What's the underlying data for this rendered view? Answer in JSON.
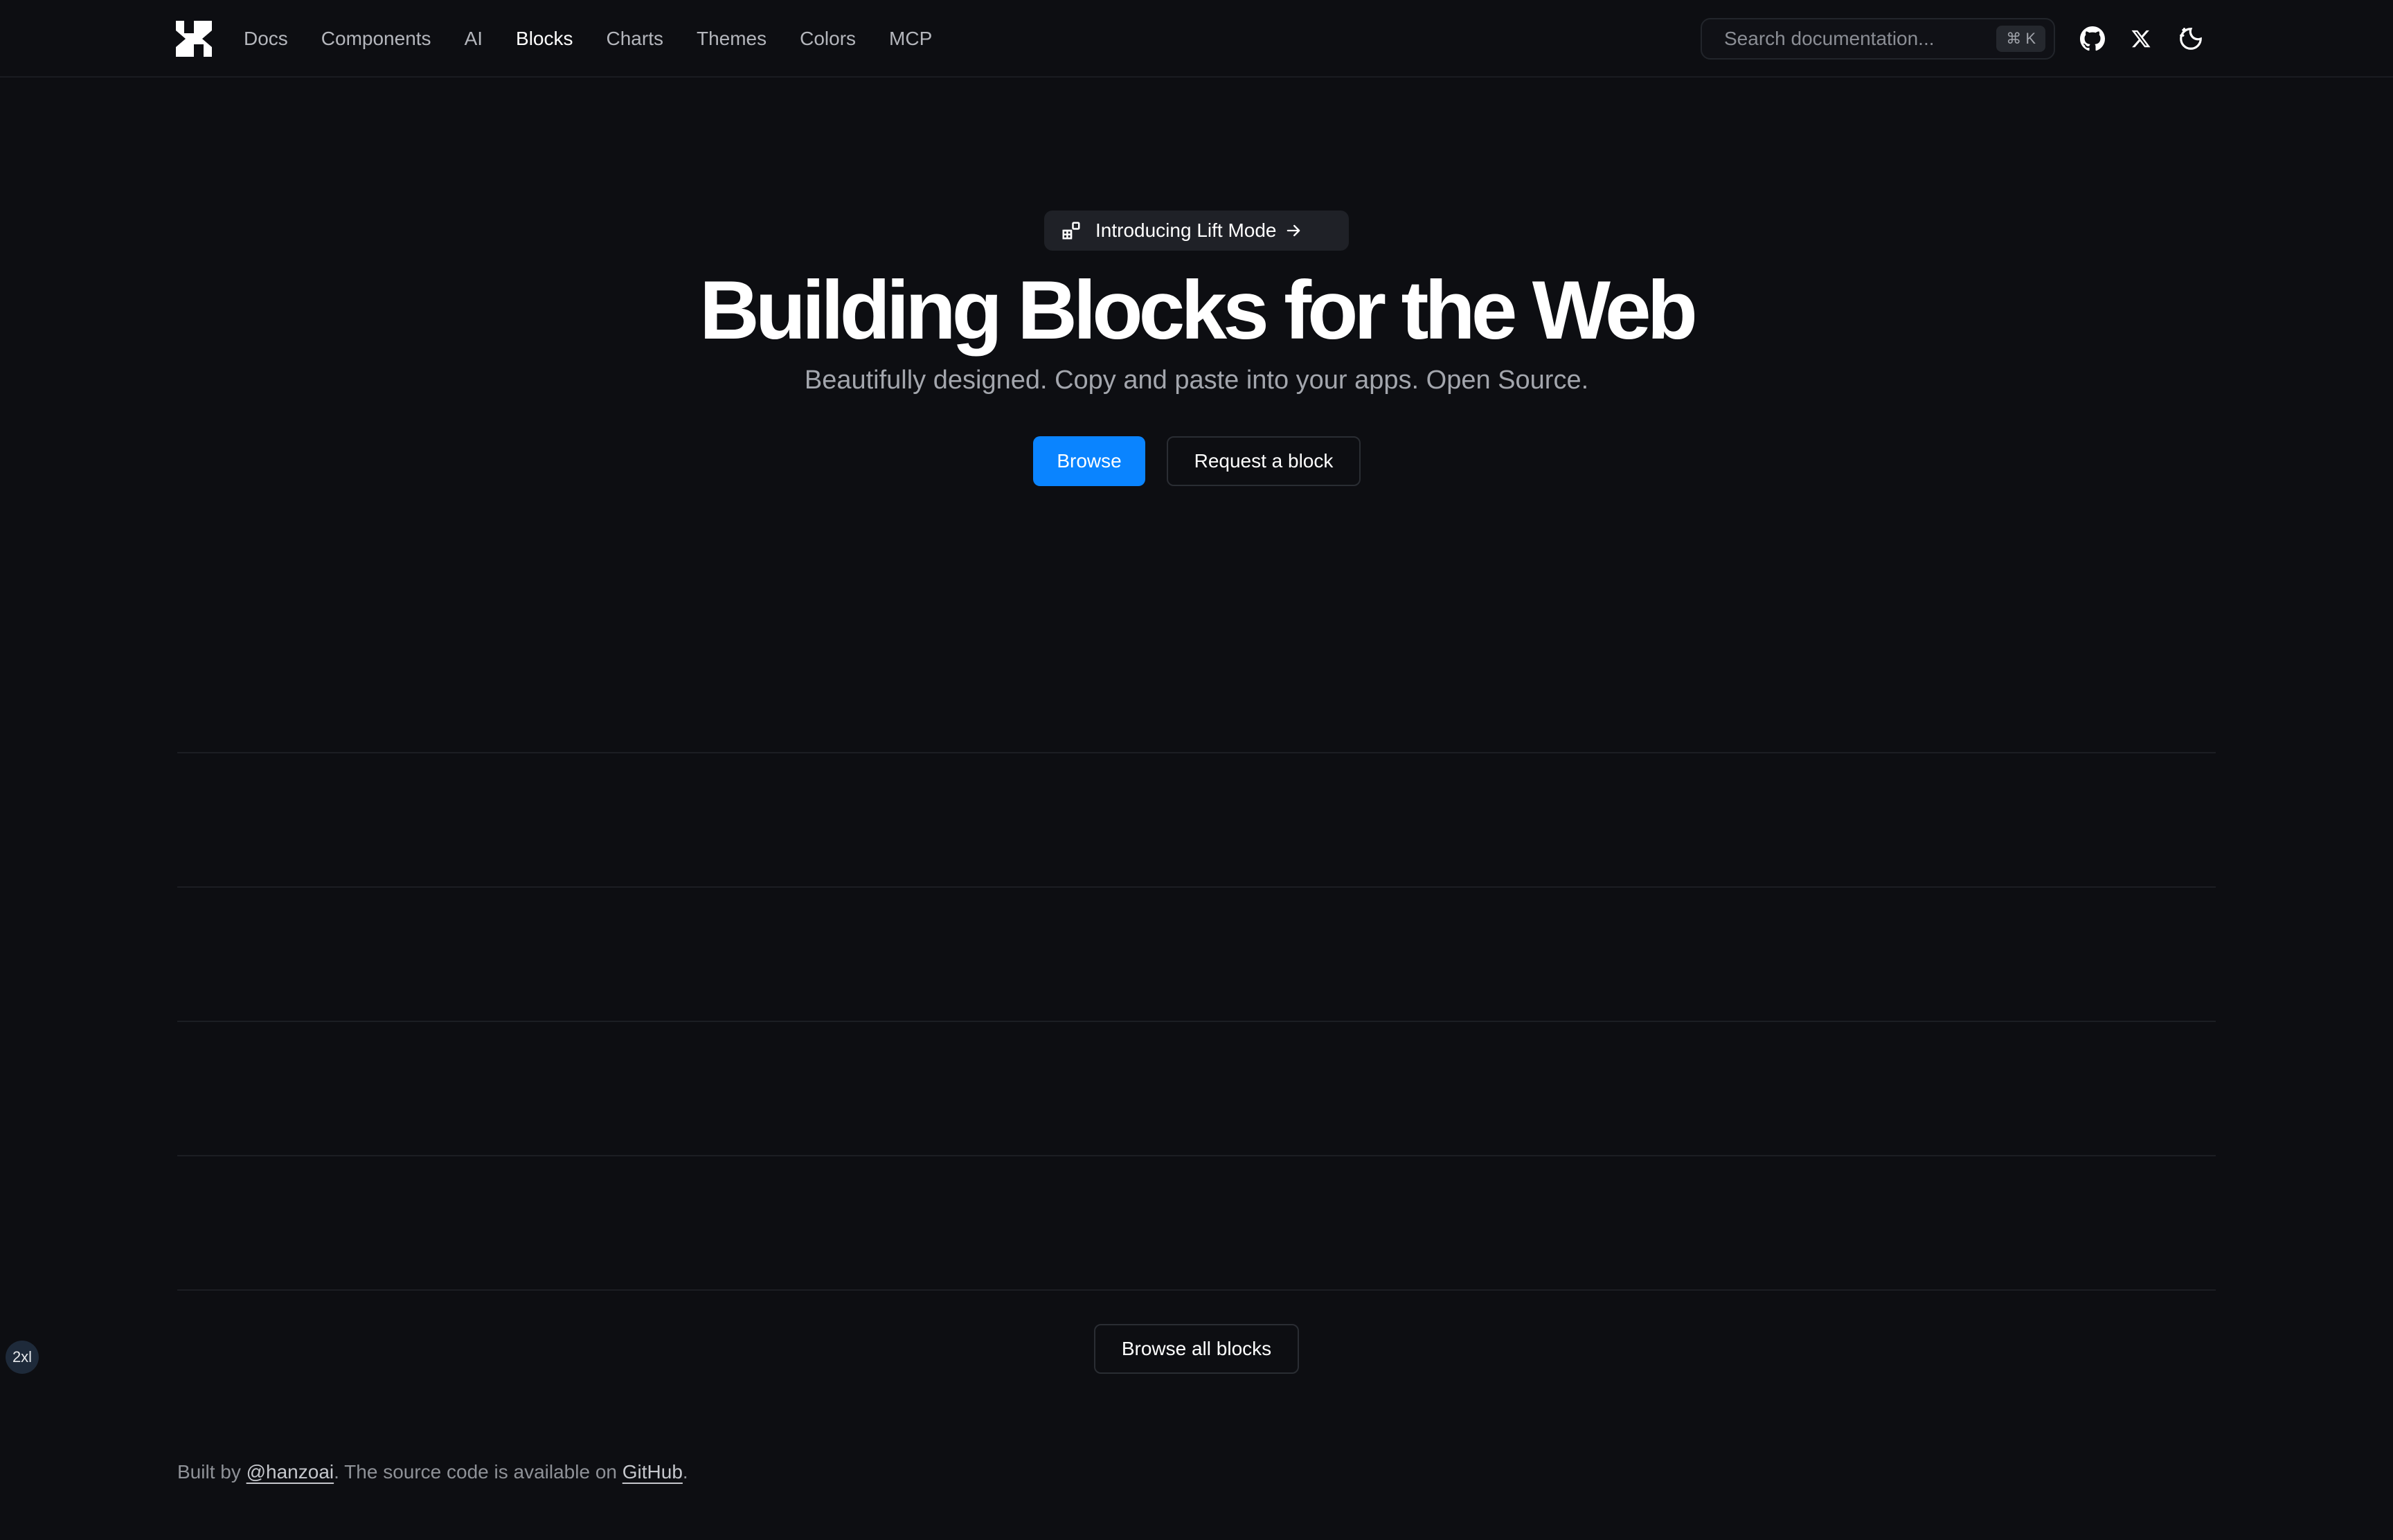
{
  "header": {
    "nav": [
      {
        "label": "Docs",
        "active": false
      },
      {
        "label": "Components",
        "active": false
      },
      {
        "label": "AI",
        "active": false
      },
      {
        "label": "Blocks",
        "active": true
      },
      {
        "label": "Charts",
        "active": false
      },
      {
        "label": "Themes",
        "active": false
      },
      {
        "label": "Colors",
        "active": false
      },
      {
        "label": "MCP",
        "active": false
      }
    ],
    "search": {
      "placeholder": "Search documentation...",
      "shortcut": "⌘ K"
    },
    "icons": [
      "github-icon",
      "x-icon",
      "theme-toggle-icon"
    ]
  },
  "hero": {
    "announcement": "Introducing Lift Mode",
    "title": "Building Blocks for the Web",
    "subtitle": "Beautifully designed. Copy and paste into your apps. Open Source.",
    "primary_button": "Browse",
    "secondary_button": "Request a block"
  },
  "browse_all_button": "Browse all blocks",
  "breakpoint_badge": "2xl",
  "footer": {
    "prefix": "Built by ",
    "author_link": "@hanzoai",
    "middle": ". The source code is available on ",
    "github_link": "GitHub",
    "suffix": "."
  },
  "colors": {
    "background": "#0d0e12",
    "accent": "#0a84ff",
    "muted_text": "#a3a6ad"
  }
}
